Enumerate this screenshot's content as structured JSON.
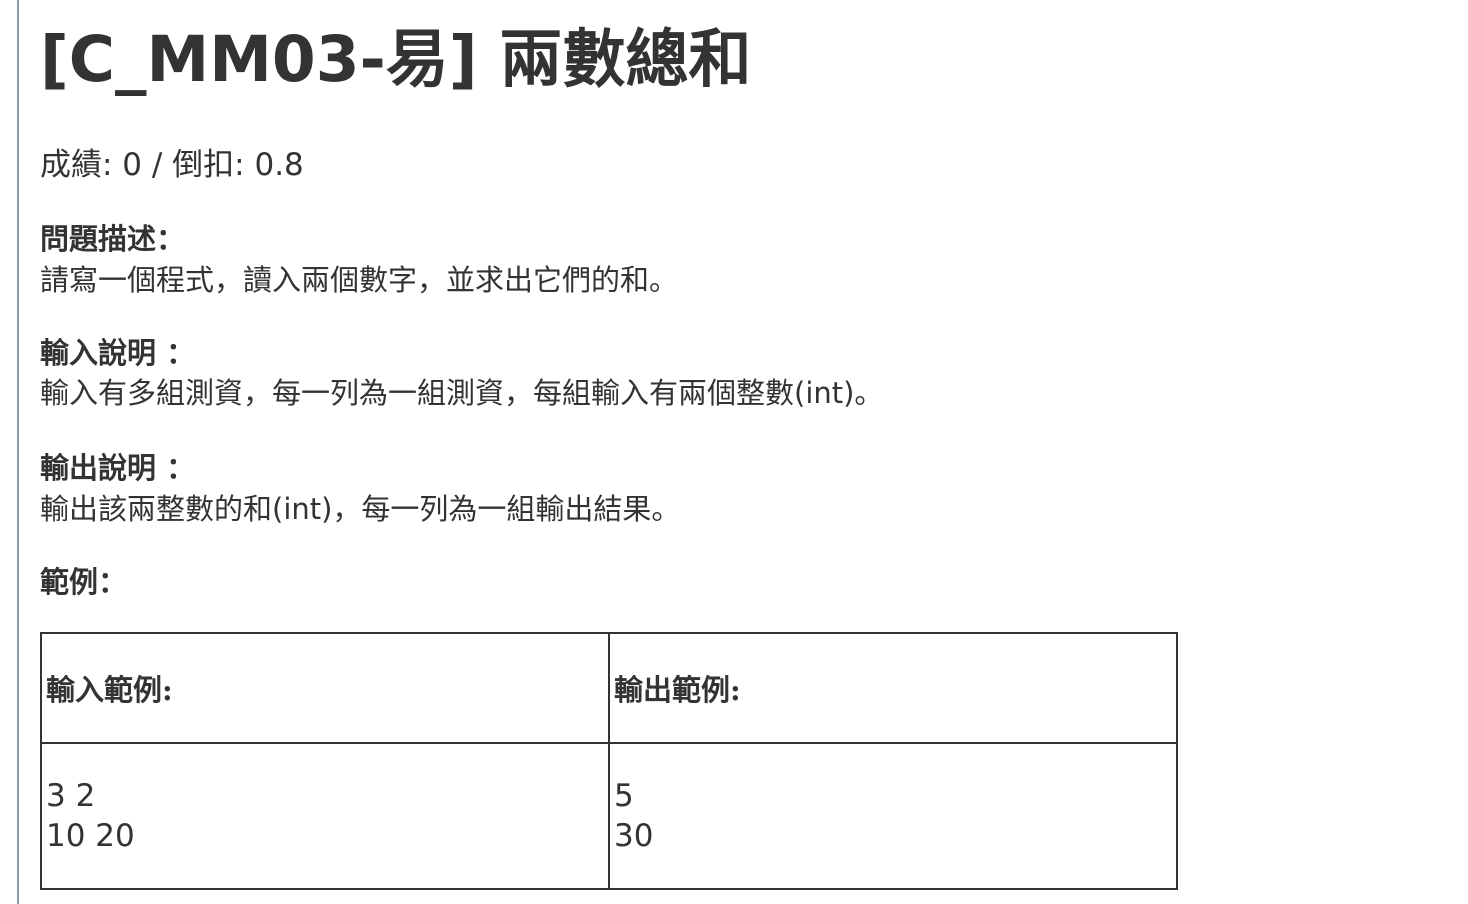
{
  "problem": {
    "title": "[C_MM03-易] 兩數總和",
    "score_line": "成績: 0 / 倒扣: 0.8"
  },
  "sections": {
    "description_label": "問題描述：",
    "description_text": "請寫一個程式，讀入兩個數字，並求出它們的和。",
    "input_label": "輸入說明 ：",
    "input_text": "輸入有多組測資，每一列為一組測資，每組輸入有兩個整數(int)。",
    "output_label": "輸出說明 ：",
    "output_text": "輸出該兩整數的和(int)，每一列為一組輸出結果。",
    "example_label": "範例："
  },
  "example_table": {
    "input_header": "輸入範例:",
    "output_header": "輸出範例:",
    "input_lines": [
      "3 2",
      "10 20"
    ],
    "output_lines": [
      "5",
      "30"
    ]
  }
}
